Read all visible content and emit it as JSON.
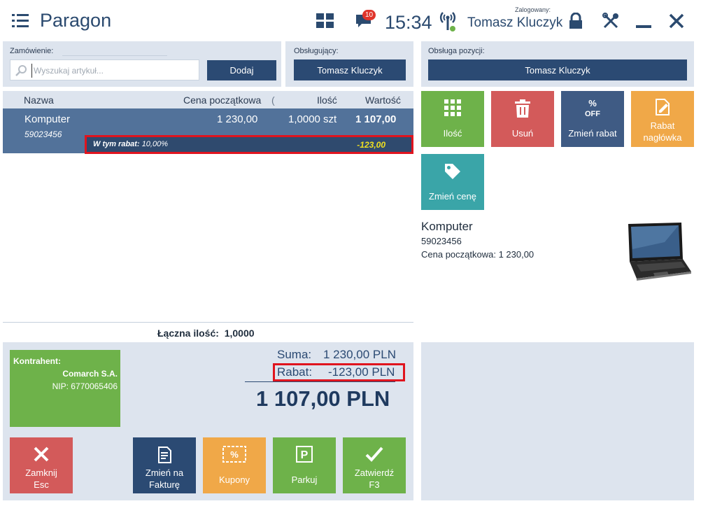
{
  "header": {
    "title": "Paragon",
    "notification_count": "10",
    "clock": "15:34",
    "logged_label": "Zalogowany:",
    "user": "Tomasz Kluczyk"
  },
  "order": {
    "label": "Zamówienie:",
    "search_placeholder": "Wyszukaj artykuł...",
    "add_button": "Dodaj"
  },
  "served_by": {
    "label": "Obsługujący:",
    "button": "Tomasz Kluczyk"
  },
  "grid": {
    "columns": [
      "Nazwa",
      "Cena początkowa",
      "Ilość",
      "Wartość"
    ],
    "rows": [
      {
        "name": "Komputer",
        "code": "59023456",
        "price": "1 230,00",
        "qty": "1,0000 szt",
        "value": "1 107,00",
        "discount_label": "W tym rabat:",
        "discount_pct": "10,00%",
        "discount_value": "-123,00"
      }
    ],
    "total_qty_label": "Łączna ilość:",
    "total_qty_value": "1,0000"
  },
  "contractor": {
    "label": "Kontrahent:",
    "name": "Comarch S.A.",
    "nip": "NIP: 6770065406"
  },
  "summary": {
    "sum_label": "Suma:",
    "sum_value": "1 230,00 PLN",
    "rabat_label": "Rabat:",
    "rabat_value": "-123,00 PLN",
    "total": "1 107,00 PLN"
  },
  "actions": {
    "close": [
      "Zamknij",
      "Esc"
    ],
    "invoice": [
      "Zmień na",
      "Fakturę"
    ],
    "coupons": "Kupony",
    "park": "Parkuj",
    "confirm": [
      "Zatwierdź",
      "F3"
    ]
  },
  "position": {
    "label": "Obsługa pozycji:",
    "button": "Tomasz Kluczyk",
    "tiles": {
      "qty": "Ilość",
      "remove": "Usuń",
      "change_discount": "Zmień rabat",
      "header_discount": [
        "Rabat",
        "nagłówka"
      ],
      "change_price": "Zmień cenę"
    }
  },
  "product": {
    "name": "Komputer",
    "code": "59023456",
    "price_line": "Cena początkowa: 1 230,00"
  },
  "colors": {
    "primary": "#2b4a73",
    "green": "#6eb24a",
    "red": "#d35a5a",
    "blue_tile": "#3f5b84",
    "orange": "#f0a848",
    "teal": "#3aa5a8",
    "discount_yellow": "#f0e020"
  }
}
